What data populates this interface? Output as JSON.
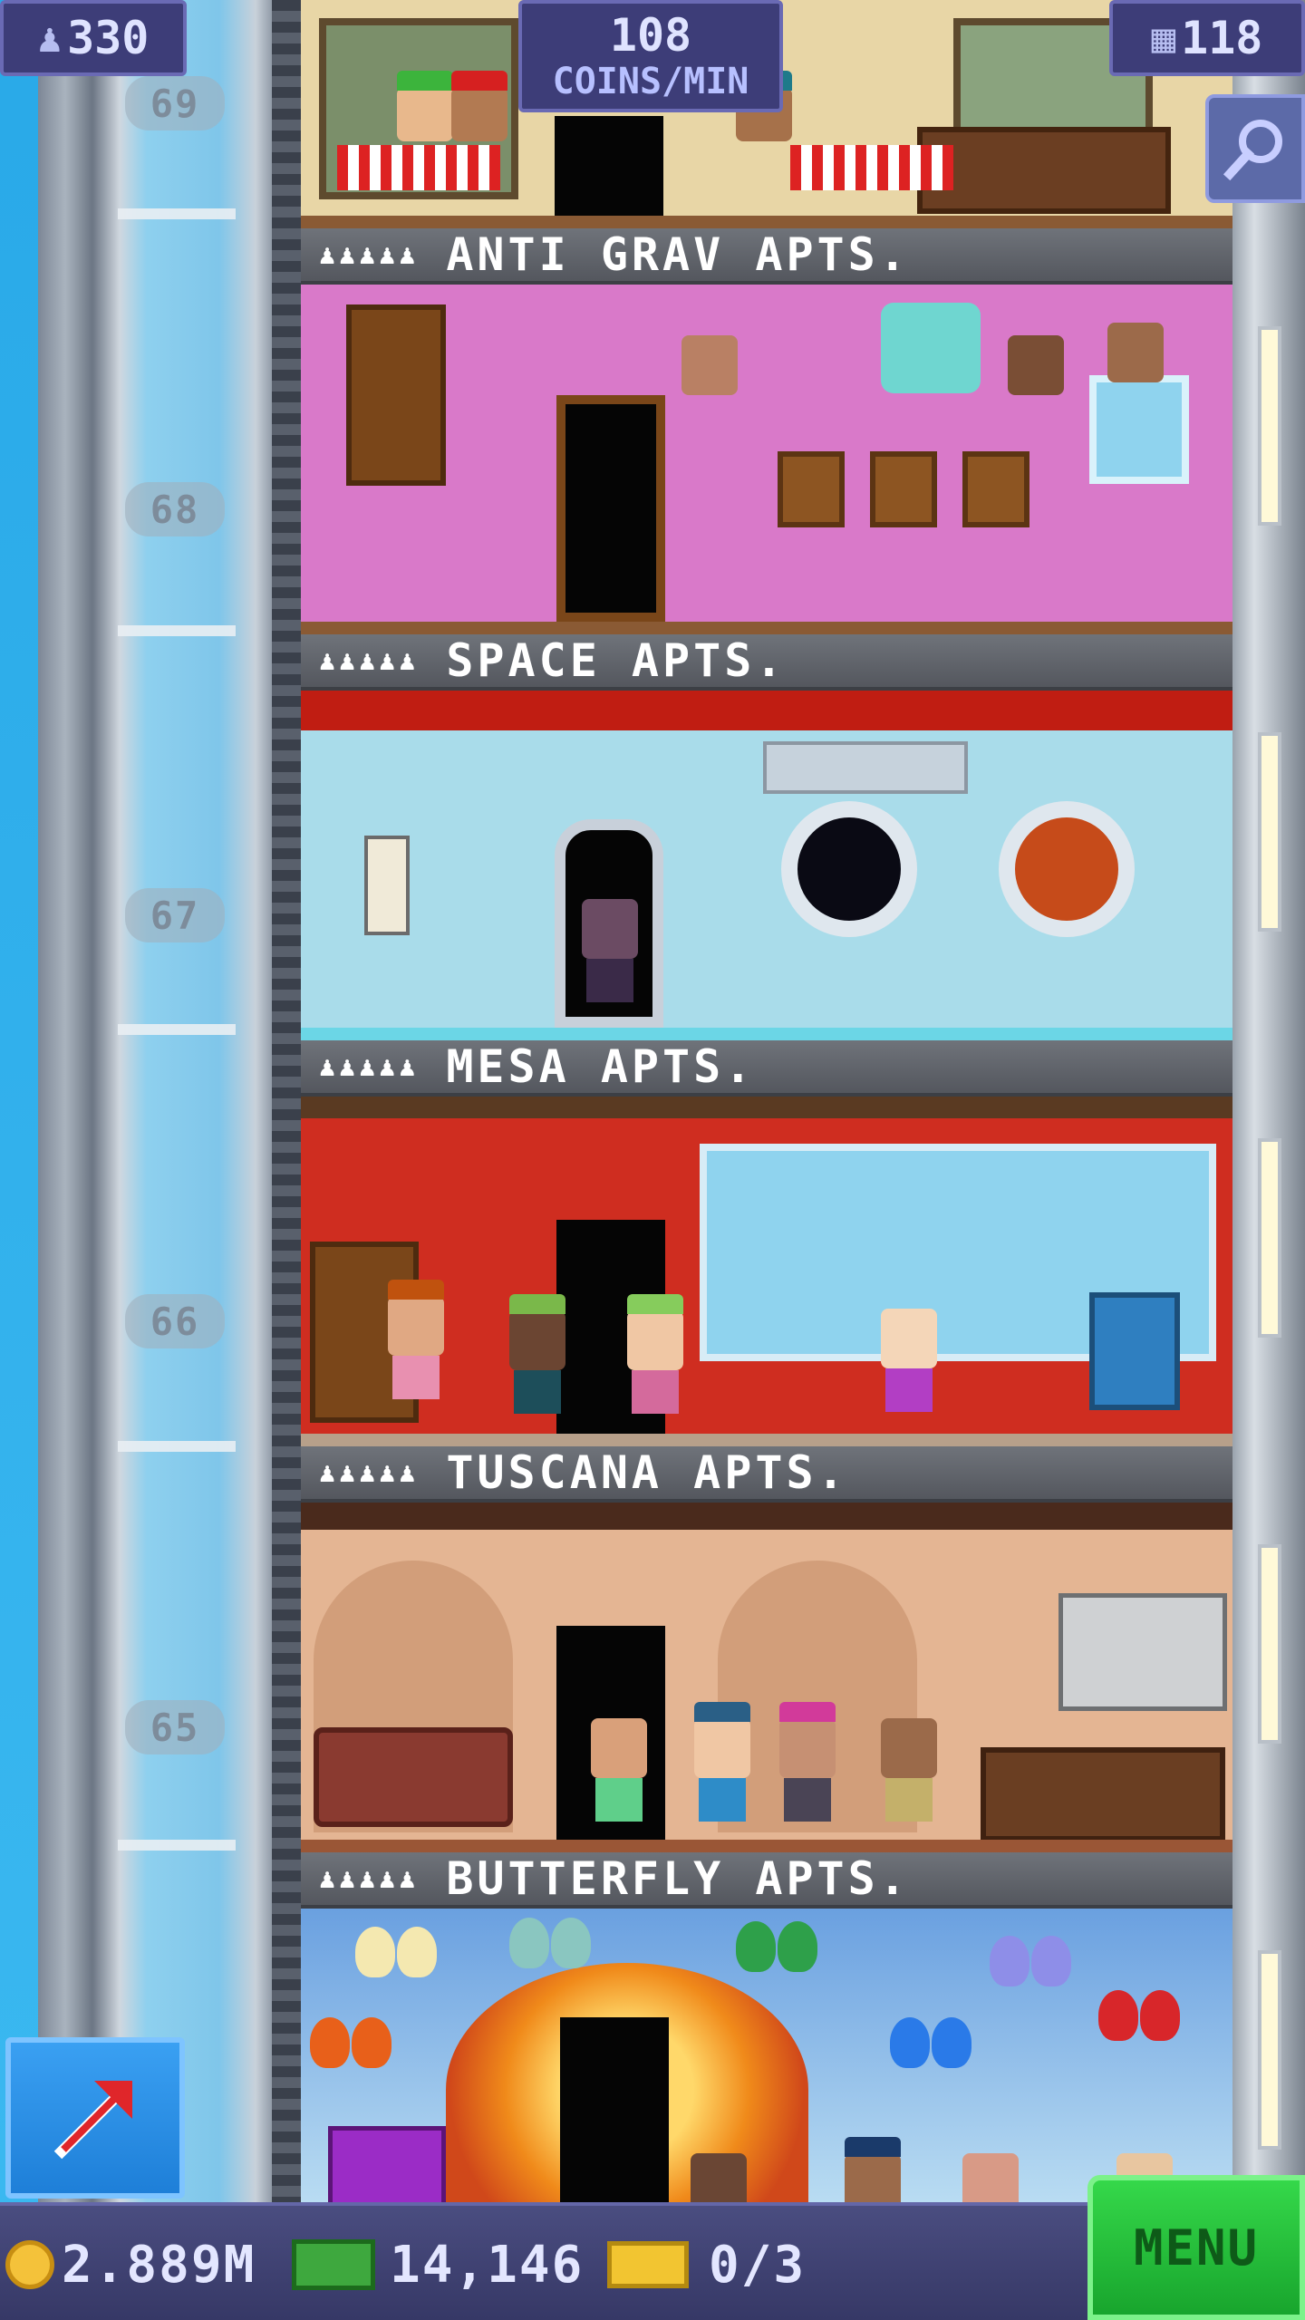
{
  "hud": {
    "population": "330",
    "coins_per_min_value": "108",
    "coins_per_min_unit": "COINS/MIN",
    "floor_count": "118"
  },
  "shaft": {
    "floor_numbers": [
      "69",
      "68",
      "67",
      "66",
      "65"
    ]
  },
  "floors": [
    {
      "stars": "♟♟♟♟♟",
      "name": "ANTI GRAV APTS.",
      "theme": "#d979c9"
    },
    {
      "stars": "♟♟♟♟♟",
      "name": "SPACE APTS.",
      "theme": "#a9dcea"
    },
    {
      "stars": "♟♟♟♟♟",
      "name": "MESA APTS.",
      "theme": "#cf2d20"
    },
    {
      "stars": "♟♟♟♟♟",
      "name": "TUSCANA APTS.",
      "theme": "#e4b593"
    },
    {
      "stars": "♟♟♟♟♟",
      "name": "BUTTERFLY APTS.",
      "theme": "#7fb2e8"
    }
  ],
  "bottom": {
    "coins": "2.889M",
    "bux": "14,146",
    "tickets": "0/3",
    "menu_label": "MENU"
  },
  "colors": {
    "hud_bg": "#3d3d78",
    "menu_green": "#18a52d",
    "lift_blue": "#1e7fd8"
  },
  "icons": {
    "population": "person-icon",
    "floors": "building-icon",
    "zoom": "magnifier-icon",
    "lift": "up-arrow-icon",
    "coin": "coin-icon",
    "bux": "bux-icon",
    "ticket": "ticket-icon"
  }
}
